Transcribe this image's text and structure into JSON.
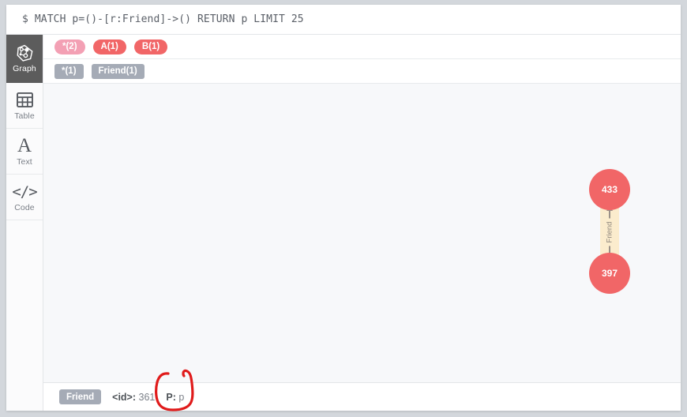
{
  "query_bar": {
    "prompt": "$",
    "query": "MATCH p=()-[r:Friend]->() RETURN p LIMIT 25"
  },
  "sidebar": {
    "items": [
      {
        "label": "Graph",
        "icon": "graph-icon",
        "active": true
      },
      {
        "label": "Table",
        "icon": "table-icon",
        "active": false
      },
      {
        "label": "Text",
        "icon": "text-icon",
        "active": false
      },
      {
        "label": "Code",
        "icon": "code-icon",
        "active": false
      }
    ]
  },
  "legend": {
    "node_labels": [
      {
        "text": "*(2)",
        "color": "#f3a0b4"
      },
      {
        "text": "A(1)",
        "color": "#f16667"
      },
      {
        "text": "B(1)",
        "color": "#f16667"
      }
    ],
    "rel_types": [
      {
        "text": "*(1)",
        "color": "#a5abb6"
      },
      {
        "text": "Friend(1)",
        "color": "#a5abb6"
      }
    ]
  },
  "graph": {
    "nodes": [
      {
        "id": "433",
        "caption": "433",
        "color": "#f16667"
      },
      {
        "id": "397",
        "caption": "397",
        "color": "#f16667"
      }
    ],
    "relationship": {
      "type": "Friend",
      "from": "397",
      "to": "433",
      "color": "#fbeccd"
    }
  },
  "status_bar": {
    "type_badge": "Friend",
    "id_key": "<id>:",
    "id_value": "361",
    "prop_key": "P:",
    "prop_value": "p"
  },
  "annotation": {
    "shape": "hand-drawn-circle",
    "color": "#e01b1b",
    "target": "P: p"
  }
}
